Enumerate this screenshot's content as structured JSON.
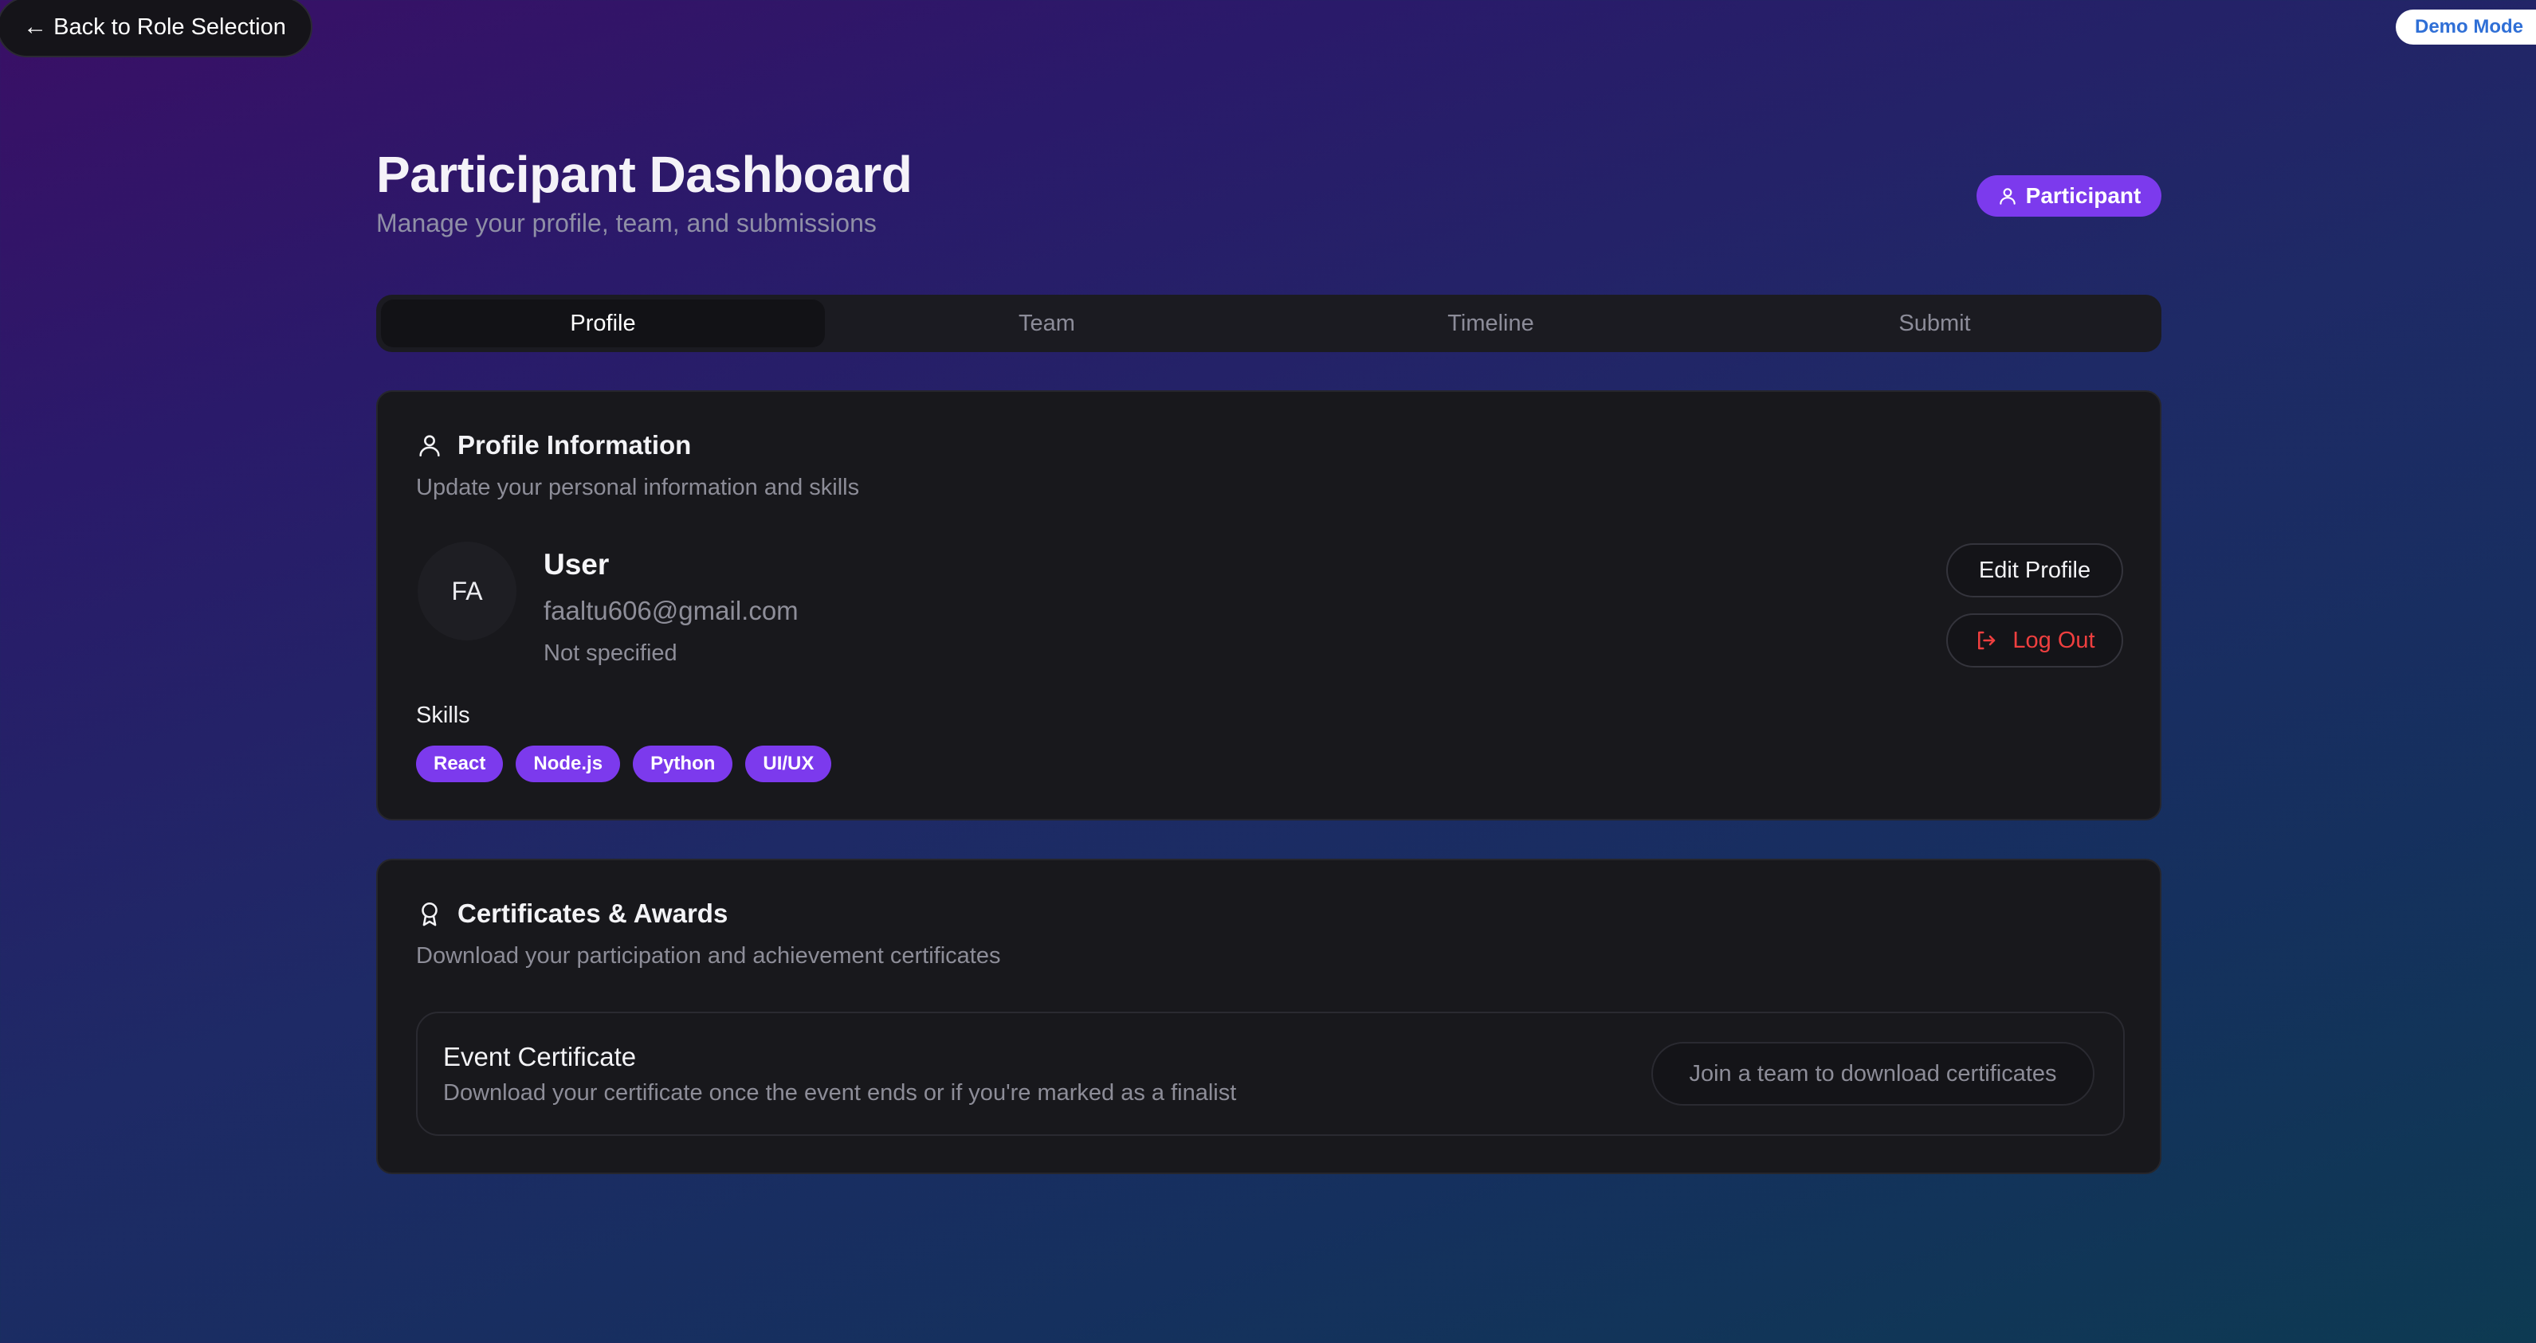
{
  "nav": {
    "back_arrow": "←",
    "back_label": "Back to Role Selection"
  },
  "demo": {
    "label": "Demo Mode"
  },
  "header": {
    "title": "Participant Dashboard",
    "subtitle": "Manage your profile, team, and submissions",
    "role_badge": "Participant",
    "role_icon": "user-icon"
  },
  "tabs": [
    {
      "label": "Profile",
      "active": true
    },
    {
      "label": "Team",
      "active": false
    },
    {
      "label": "Timeline",
      "active": false
    },
    {
      "label": "Submit",
      "active": false
    }
  ],
  "profile": {
    "icon": "user-icon",
    "title": "Profile Information",
    "description": "Update your personal information and skills",
    "avatar_initials": "FA",
    "name": "User",
    "email": "faaltu606@gmail.com",
    "location": "Not specified",
    "edit_button": "Edit Profile",
    "logout_button": "Log Out",
    "logout_icon": "logout-icon",
    "skills_label": "Skills",
    "skills": [
      "React",
      "Node.js",
      "Python",
      "UI/UX"
    ]
  },
  "certificates": {
    "icon": "award-icon",
    "title": "Certificates & Awards",
    "description": "Download your participation and achievement certificates",
    "item_title": "Event Certificate",
    "item_description": "Download your certificate once the event ends or if you're marked as a finalist",
    "action_label": "Join a team to download certificates"
  },
  "colors": {
    "accent": "#7c3aed",
    "danger": "#ef3f3f",
    "card": "#18181c",
    "demo_text": "#2f6fd6"
  }
}
